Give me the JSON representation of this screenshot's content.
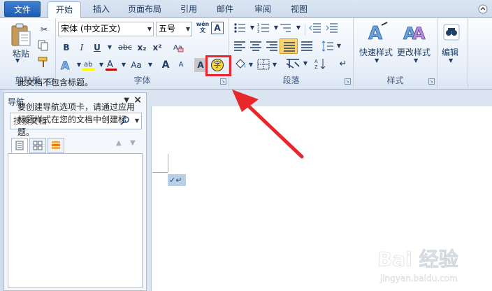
{
  "tabs": [
    "文件",
    "开始",
    "插入",
    "页面布局",
    "引用",
    "邮件",
    "审阅",
    "视图"
  ],
  "clipboard": {
    "paste_label": "粘贴",
    "group_label": "剪贴板"
  },
  "font": {
    "family_value": "宋体 (中文正文)",
    "size_value": "五号",
    "group_label": "字体",
    "pinyin_glyph": "wén",
    "bold": "B",
    "italic": "I",
    "underline": "U",
    "strike": "abc",
    "sub": "x₂",
    "sup": "x²",
    "grow": "A",
    "shrink": "A",
    "change_case": "Aa",
    "highlight_letter": "A",
    "char_border_glyph": "A",
    "enclose_glyph": "字"
  },
  "paragraph": {
    "group_label": "段落"
  },
  "styles": {
    "quick_label": "快速样式",
    "change_label": "更改样式",
    "group_label": "样式"
  },
  "editing": {
    "label": "编辑"
  },
  "nav": {
    "title": "导航",
    "search_placeholder": "搜索文档",
    "message1": "此文档不包含标题。",
    "message2": "要创建导航选项卡，请通过应用标题样式在您的文档中创建标题。"
  },
  "colors": {
    "accent": "#1d5fb5",
    "highlight_red": "#e8262b",
    "font_color_red": "#c00000",
    "highlight_yellow": "#ffff00"
  },
  "watermark_text": "Bai 经验",
  "watermark_url": "jingyan.baidu.com"
}
